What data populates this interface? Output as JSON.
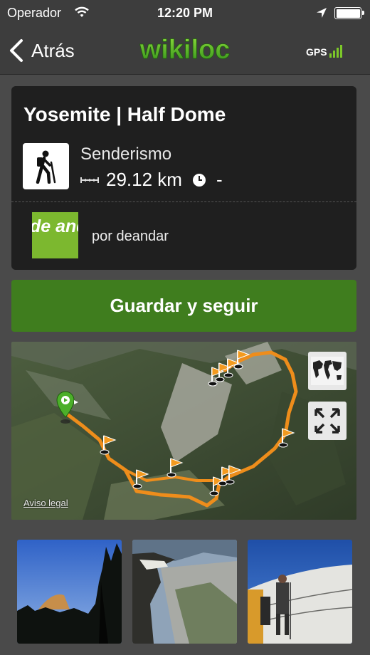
{
  "status_bar": {
    "carrier": "Operador",
    "time": "12:20 PM",
    "icons": [
      "wifi-icon",
      "location-arrow-icon",
      "battery-icon"
    ]
  },
  "nav": {
    "back_label": "Atrás",
    "logo_text": "wikiloc",
    "gps_label": "GPS"
  },
  "trail": {
    "title": "Yosemite | Half Dome",
    "activity": "Senderismo",
    "distance": "29.12 km",
    "duration": "-",
    "author": "por deandar",
    "avatar_text": "de andar"
  },
  "actions": {
    "save_label": "Guardar y seguir"
  },
  "map": {
    "legal_label": "Aviso legal",
    "buttons": [
      "world-map-icon",
      "fullscreen-expand-icon"
    ]
  },
  "photos": [
    "Half Dome at dusk",
    "Cliff overlook valley",
    "Half Dome cables climbers"
  ],
  "colors": {
    "accent_green": "#3f7d1e",
    "track_orange": "#f5a623",
    "card_bg": "#1f1f1f",
    "bg": "#4a4a4a"
  }
}
